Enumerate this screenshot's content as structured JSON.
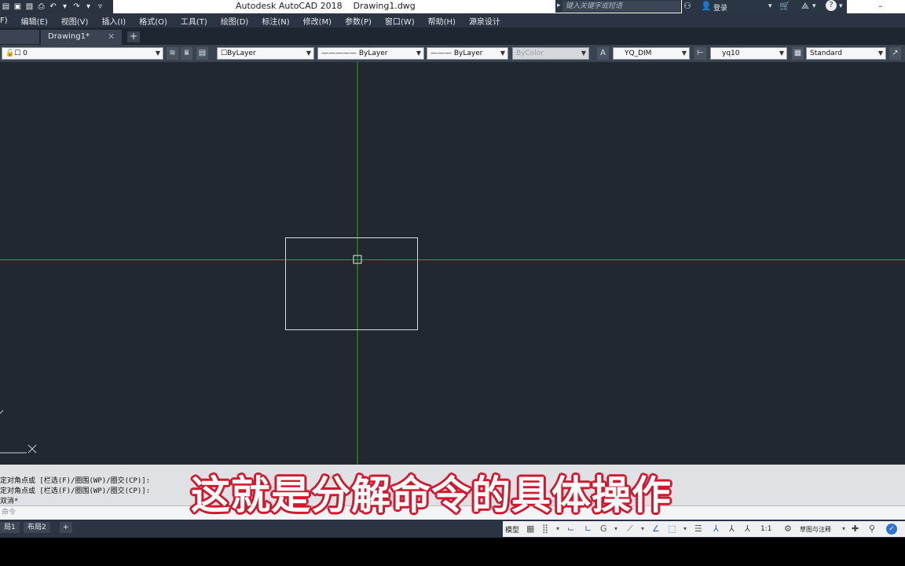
{
  "title": {
    "app": "Autodesk AutoCAD 2018",
    "file": "Drawing1.dwg",
    "search_placeholder": "键入关键字或短语",
    "login": "登录"
  },
  "menu": [
    "F)",
    "编辑(E)",
    "视图(V)",
    "插入(I)",
    "格式(O)",
    "工具(T)",
    "绘图(D)",
    "标注(N)",
    "修改(M)",
    "参数(P)",
    "窗口(W)",
    "帮助(H)",
    "源泉设计"
  ],
  "tabs": {
    "drawing": "Drawing1*",
    "close": "✕",
    "add": "+"
  },
  "properties": {
    "layer": "0",
    "color": "ByLayer",
    "linetype": "ByLayer",
    "lineweight": "ByLayer",
    "plotstyle": "ByColor",
    "dimstyle": "YQ_DIM",
    "tablestyle": "yq10",
    "textstyle": "Standard"
  },
  "command": {
    "history": [
      "定对角点或 [栏选(F)/圈围(WP)/圈交(CP)]:",
      "定对角点或 [栏选(F)/圈围(WP)/圈交(CP)]:",
      "双消*"
    ],
    "prompt": "命令"
  },
  "layout_tabs": [
    "局1",
    "布局2"
  ],
  "status": {
    "model": "模型",
    "scale": "1:1",
    "workspace": "草图与注释"
  },
  "subtitle": "这就是分解命令的具体操作",
  "colors": {
    "canvas": "#212830",
    "crosshair_v": "#2ea82e",
    "crosshair_h": "#b85a44",
    "selection": "#d8dde3",
    "subtitle_stroke": "#d1182e"
  }
}
